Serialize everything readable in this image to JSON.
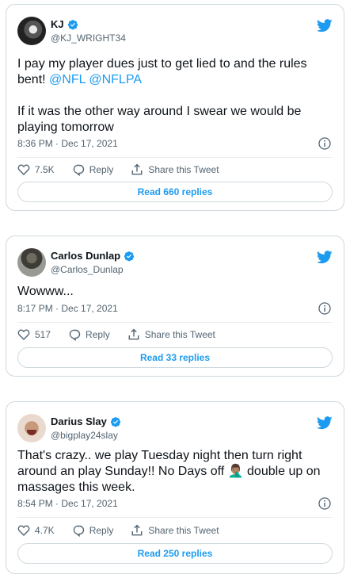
{
  "colors": {
    "accent": "#1d9bf0",
    "text": "#0f1419",
    "muted": "#536471",
    "border": "#cfd9de"
  },
  "tweets": [
    {
      "name": "KJ",
      "handle": "@KJ_WRIGHT34",
      "text_pre": "I pay my player dues just to get lied to and the rules bent! ",
      "mention1": "@NFL",
      "mention_sep": " ",
      "mention2": "@NFLPA",
      "text_post": "If it was the other way around I swear we would be playing tomorrow",
      "timestamp": "8:36 PM · Dec 17, 2021",
      "likes": "7.5K",
      "reply_label": "Reply",
      "share_label": "Share this Tweet",
      "read_label": "Read 660 replies"
    },
    {
      "name": "Carlos Dunlap",
      "handle": "@Carlos_Dunlap",
      "text": "Wowww...",
      "timestamp": "8:17 PM · Dec 17, 2021",
      "likes": "517",
      "reply_label": "Reply",
      "share_label": "Share this Tweet",
      "read_label": "Read 33 replies"
    },
    {
      "name": "Darius Slay",
      "handle": "@bigplay24slay",
      "text": "That's crazy.. we play Tuesday night then turn right around an play Sunday!! No Days off 🤦🏽‍♂️ double up on massages this week.",
      "timestamp": "8:54 PM · Dec 17, 2021",
      "likes": "4.7K",
      "reply_label": "Reply",
      "share_label": "Share this Tweet",
      "read_label": "Read 250 replies"
    }
  ],
  "icons": [
    "verified-badge-icon",
    "twitter-bird-icon",
    "info-icon",
    "heart-icon",
    "reply-icon",
    "share-icon"
  ]
}
